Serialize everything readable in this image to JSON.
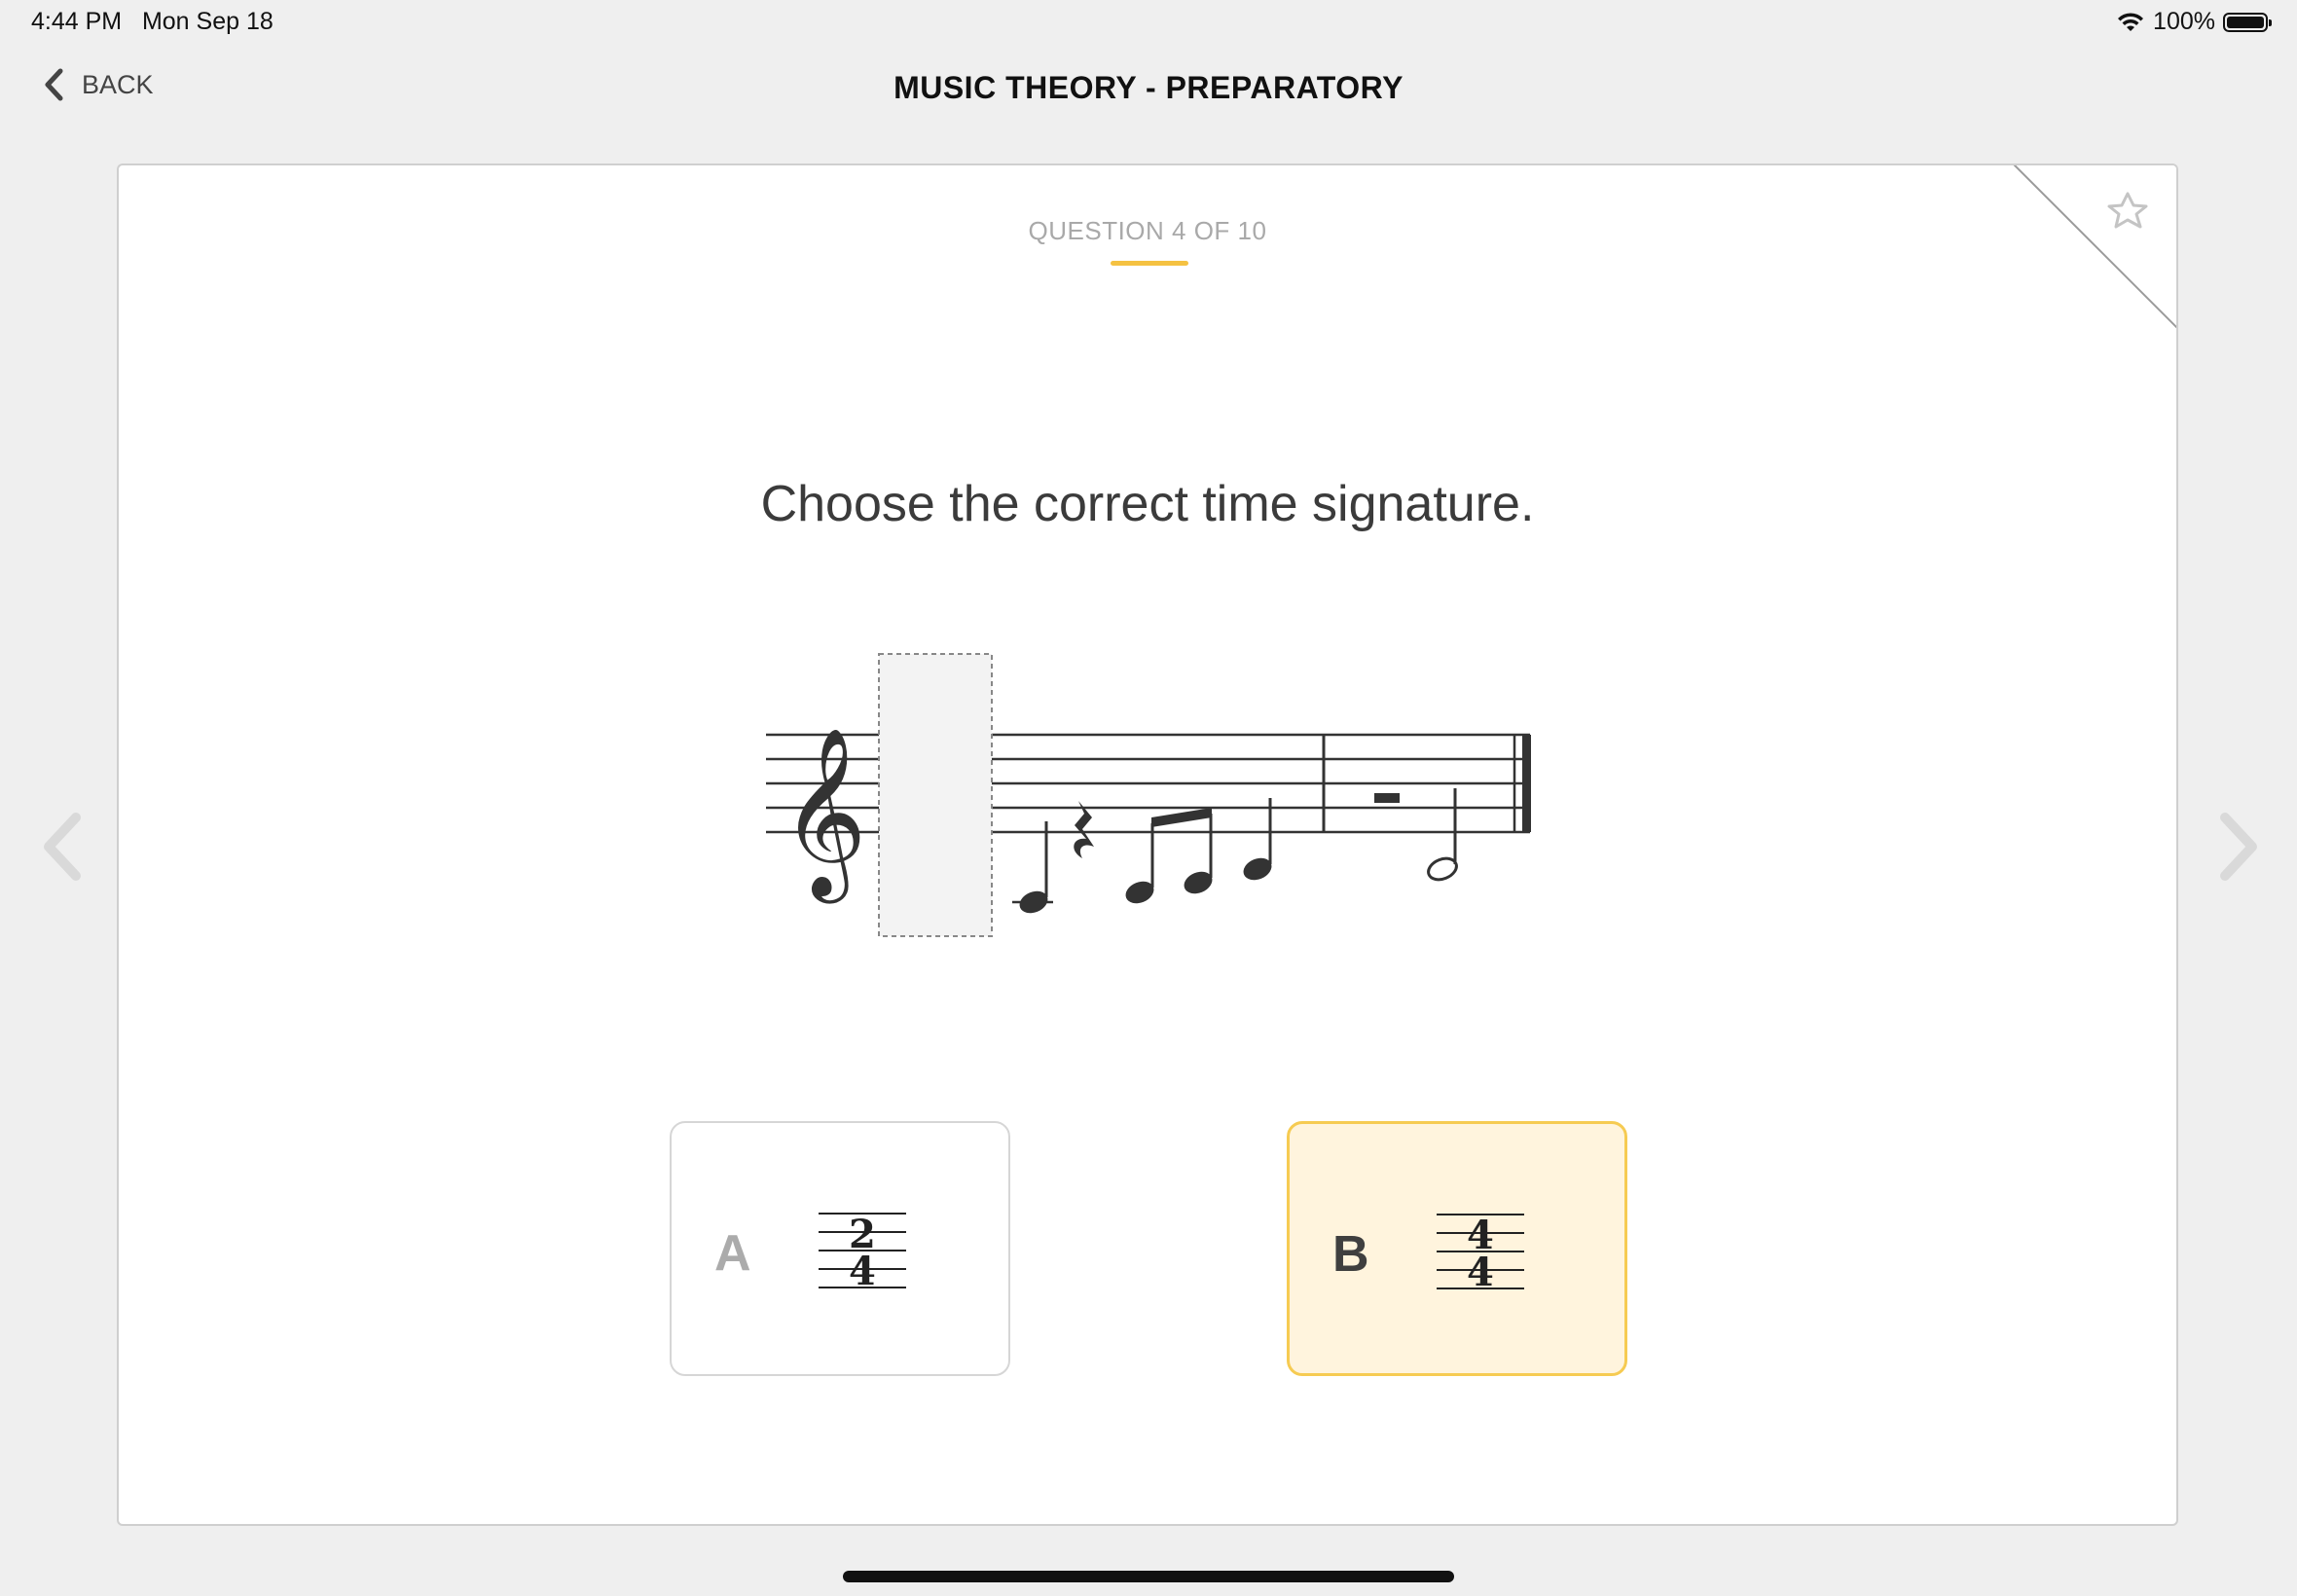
{
  "status_bar": {
    "time": "4:44 PM",
    "date": "Mon Sep 18",
    "battery_percent": "100%",
    "battery_level": 1.0
  },
  "nav": {
    "back_label": "BACK",
    "title": "MUSIC THEORY - PREPARATORY"
  },
  "card": {
    "counter": "QUESTION 4 OF 10",
    "prompt": "Choose the correct time signature.",
    "favorited": false
  },
  "options": [
    {
      "letter": "A",
      "numerator": "2",
      "denominator": "4",
      "selected": false
    },
    {
      "letter": "B",
      "numerator": "4",
      "denominator": "4",
      "selected": true
    }
  ],
  "colors": {
    "accent": "#f5c242",
    "selected_bg": "#fff4dd",
    "background": "#efefef"
  },
  "icons": {
    "back": "chevron-left-icon",
    "favorite": "star-outline-icon",
    "prev": "chevron-left-icon",
    "next": "chevron-right-icon",
    "wifi": "wifi-icon",
    "battery": "battery-icon"
  }
}
